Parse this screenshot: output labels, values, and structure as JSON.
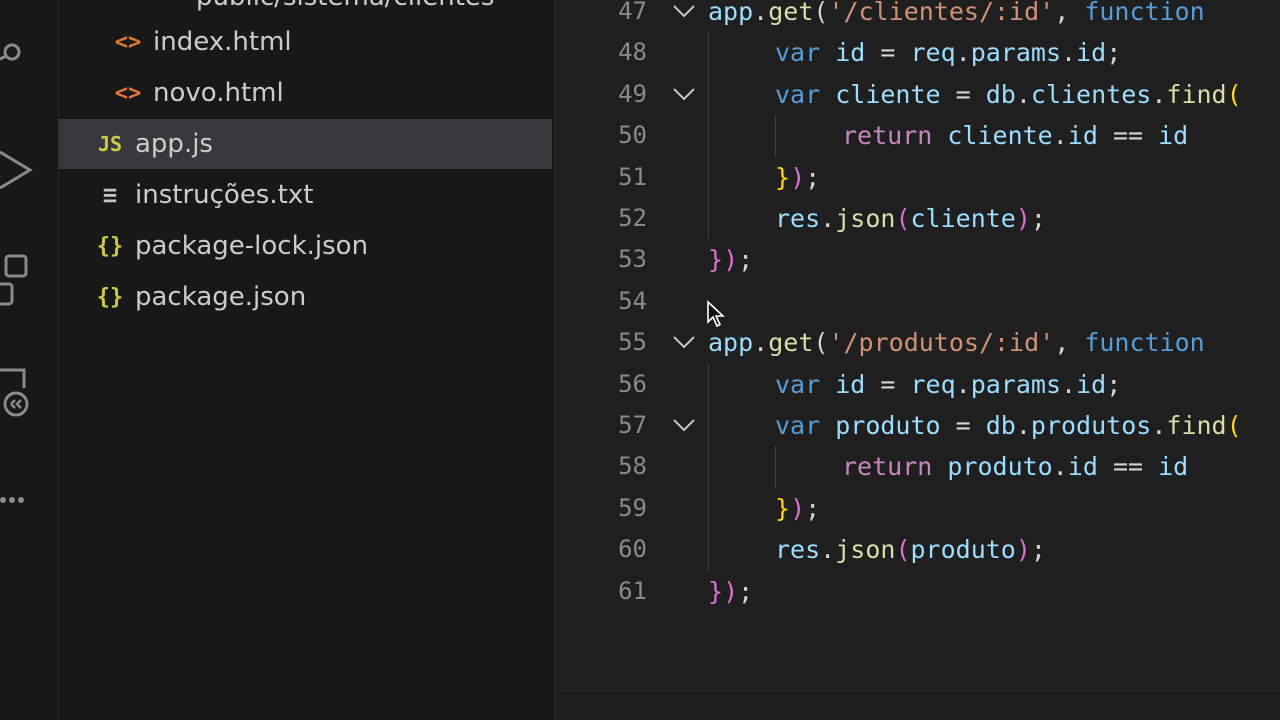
{
  "sidebar": {
    "cut_path": "public/sistema/clientes",
    "files": [
      {
        "name": "index.html",
        "type": "html",
        "icon": "html-file-icon",
        "glyph": "<>",
        "indent": 1,
        "selected": false
      },
      {
        "name": "novo.html",
        "type": "html",
        "icon": "html-file-icon",
        "glyph": "<>",
        "indent": 1,
        "selected": false
      },
      {
        "name": "app.js",
        "type": "js",
        "icon": "js-file-icon",
        "glyph": "JS",
        "indent": 0,
        "selected": true
      },
      {
        "name": "instruções.txt",
        "type": "txt",
        "icon": "text-file-icon",
        "glyph": "≡",
        "indent": 0,
        "selected": false
      },
      {
        "name": "package-lock.json",
        "type": "json",
        "icon": "json-file-icon",
        "glyph": "{}",
        "indent": 0,
        "selected": false
      },
      {
        "name": "package.json",
        "type": "json",
        "icon": "json-file-icon",
        "glyph": "{}",
        "indent": 0,
        "selected": false
      }
    ]
  },
  "editor": {
    "lines": [
      {
        "n": "47",
        "fold": true,
        "indent": 0,
        "tokens": [
          [
            "app",
            "var"
          ],
          [
            ".",
            "p"
          ],
          [
            "get",
            "fn"
          ],
          [
            "(",
            "p"
          ],
          [
            "'/clientes/:id'",
            "str"
          ],
          [
            ", ",
            "p"
          ],
          [
            "function",
            "kw"
          ]
        ]
      },
      {
        "n": "48",
        "fold": false,
        "indent": 1,
        "tokens": [
          [
            "var",
            "kw"
          ],
          [
            " ",
            "p"
          ],
          [
            "id",
            "var"
          ],
          [
            " = ",
            "p"
          ],
          [
            "req",
            "var"
          ],
          [
            ".",
            "p"
          ],
          [
            "params",
            "var"
          ],
          [
            ".",
            "p"
          ],
          [
            "id",
            "var"
          ],
          [
            ";",
            "p"
          ]
        ]
      },
      {
        "n": "49",
        "fold": true,
        "indent": 1,
        "tokens": [
          [
            "var",
            "kw"
          ],
          [
            " ",
            "p"
          ],
          [
            "cliente",
            "var"
          ],
          [
            " = ",
            "p"
          ],
          [
            "db",
            "var"
          ],
          [
            ".",
            "p"
          ],
          [
            "clientes",
            "var"
          ],
          [
            ".",
            "p"
          ],
          [
            "find",
            "fn"
          ],
          [
            "(",
            "b1"
          ]
        ]
      },
      {
        "n": "50",
        "fold": false,
        "indent": 2,
        "tokens": [
          [
            "return",
            "ret"
          ],
          [
            " ",
            "p"
          ],
          [
            "cliente",
            "var"
          ],
          [
            ".",
            "p"
          ],
          [
            "id",
            "var"
          ],
          [
            " == ",
            "p"
          ],
          [
            "id",
            "var"
          ]
        ]
      },
      {
        "n": "51",
        "fold": false,
        "indent": 1,
        "tokens": [
          [
            "}",
            "b1"
          ],
          [
            ")",
            "b2"
          ],
          [
            ";",
            "p"
          ]
        ]
      },
      {
        "n": "52",
        "fold": false,
        "indent": 1,
        "tokens": [
          [
            "res",
            "var"
          ],
          [
            ".",
            "p"
          ],
          [
            "json",
            "fn"
          ],
          [
            "(",
            "b2"
          ],
          [
            "cliente",
            "var"
          ],
          [
            ")",
            "b2"
          ],
          [
            ";",
            "p"
          ]
        ]
      },
      {
        "n": "53",
        "fold": false,
        "indent": 0,
        "tokens": [
          [
            "}",
            "b3"
          ],
          [
            ")",
            "b3"
          ],
          [
            ";",
            "p"
          ]
        ]
      },
      {
        "n": "54",
        "fold": false,
        "indent": 0,
        "tokens": []
      },
      {
        "n": "55",
        "fold": true,
        "indent": 0,
        "tokens": [
          [
            "app",
            "var"
          ],
          [
            ".",
            "p"
          ],
          [
            "get",
            "fn"
          ],
          [
            "(",
            "p"
          ],
          [
            "'/produtos/:id'",
            "str"
          ],
          [
            ", ",
            "p"
          ],
          [
            "function",
            "kw"
          ]
        ]
      },
      {
        "n": "56",
        "fold": false,
        "indent": 1,
        "tokens": [
          [
            "var",
            "kw"
          ],
          [
            " ",
            "p"
          ],
          [
            "id",
            "var"
          ],
          [
            " = ",
            "p"
          ],
          [
            "req",
            "var"
          ],
          [
            ".",
            "p"
          ],
          [
            "params",
            "var"
          ],
          [
            ".",
            "p"
          ],
          [
            "id",
            "var"
          ],
          [
            ";",
            "p"
          ]
        ]
      },
      {
        "n": "57",
        "fold": true,
        "indent": 1,
        "tokens": [
          [
            "var",
            "kw"
          ],
          [
            " ",
            "p"
          ],
          [
            "produto",
            "var"
          ],
          [
            " = ",
            "p"
          ],
          [
            "db",
            "var"
          ],
          [
            ".",
            "p"
          ],
          [
            "produtos",
            "var"
          ],
          [
            ".",
            "p"
          ],
          [
            "find",
            "fn"
          ],
          [
            "(",
            "b1"
          ]
        ]
      },
      {
        "n": "58",
        "fold": false,
        "indent": 2,
        "tokens": [
          [
            "return",
            "ret"
          ],
          [
            " ",
            "p"
          ],
          [
            "produto",
            "var"
          ],
          [
            ".",
            "p"
          ],
          [
            "id",
            "var"
          ],
          [
            " == ",
            "p"
          ],
          [
            "id",
            "var"
          ]
        ]
      },
      {
        "n": "59",
        "fold": false,
        "indent": 1,
        "tokens": [
          [
            "}",
            "b1"
          ],
          [
            ")",
            "b2"
          ],
          [
            ";",
            "p"
          ]
        ]
      },
      {
        "n": "60",
        "fold": false,
        "indent": 1,
        "tokens": [
          [
            "res",
            "var"
          ],
          [
            ".",
            "p"
          ],
          [
            "json",
            "fn"
          ],
          [
            "(",
            "b2"
          ],
          [
            "produto",
            "var"
          ],
          [
            ")",
            "b2"
          ],
          [
            ";",
            "p"
          ]
        ]
      },
      {
        "n": "61",
        "fold": false,
        "indent": 0,
        "tokens": [
          [
            "}",
            "b3"
          ],
          [
            ")",
            "b3"
          ],
          [
            ";",
            "p"
          ]
        ]
      }
    ]
  },
  "colors": {
    "var": "#9cdcfe",
    "fn": "#dcdcaa",
    "str": "#ce9178",
    "kw": "#569cd6",
    "ret": "#c586c0",
    "p": "#d4d4d4",
    "b1": "#ffd700",
    "b2": "#da70d6",
    "b3": "#da70d6",
    "selected_bg": "#37373d"
  }
}
